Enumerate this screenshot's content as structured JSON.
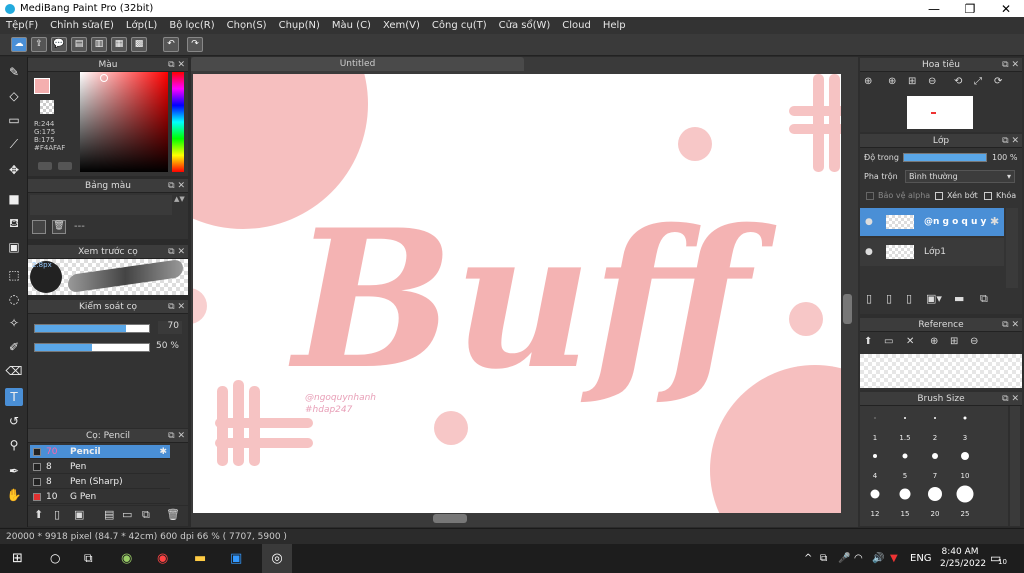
{
  "window": {
    "title": "MediBang Paint Pro (32bit)",
    "controls": [
      "—",
      "❐",
      "✕"
    ]
  },
  "menu": [
    "Tệp(F)",
    "Chỉnh sửa(E)",
    "Lớp(L)",
    "Bộ lọc(R)",
    "Chọn(S)",
    "Chụp(N)",
    "Màu (C)",
    "Xem(V)",
    "Công cụ(T)",
    "Cửa sổ(W)",
    "Cloud",
    "Help"
  ],
  "color_panel": {
    "title": "Màu",
    "r": "R:244",
    "g": "G:175",
    "b": "B:175",
    "hex": "#F4AFAF",
    "fg_color": "#F4AFAF"
  },
  "palette_panel": {
    "title": "Bảng màu",
    "value": "---"
  },
  "preview_panel": {
    "title": "Xem trước cọ",
    "size": "2.8px"
  },
  "brush_control": {
    "title": "Kiểm soát cọ",
    "size_value": "70",
    "size_fill": 0.8,
    "opacity_value": "50 %",
    "opacity_fill": 0.5
  },
  "brush_list": {
    "title": "Cọ: Pencil",
    "items": [
      {
        "size": "70",
        "name": "Pencil",
        "color": "#222222",
        "selected": true
      },
      {
        "size": "8",
        "name": "Pen",
        "color": "#222222",
        "selected": false
      },
      {
        "size": "8",
        "name": "Pen (Sharp)",
        "color": "#222222",
        "selected": false
      },
      {
        "size": "10",
        "name": "G Pen",
        "color": "#e03030",
        "selected": false
      }
    ]
  },
  "canvas": {
    "tab": "Untitled",
    "main_text": "Buff",
    "watermark_line1": "@ngoquynhanh",
    "watermark_line2": "#hdap247",
    "accent": "#F4AFAF"
  },
  "navigator": {
    "title": "Hoa tiêu"
  },
  "layer_panel": {
    "title": "Lớp",
    "opacity_label": "Độ trong",
    "opacity_value": "100 %",
    "opacity_fill": 1.0,
    "blend_label": "Pha trộn",
    "blend_value": "Bình thường",
    "protect_alpha": "Bảo vệ alpha",
    "clipping": "Xén bớt",
    "lock": "Khóa",
    "layers": [
      {
        "name": "@n g o q u y",
        "selected": true
      },
      {
        "name": "Lớp1",
        "selected": false
      }
    ]
  },
  "reference_panel": {
    "title": "Reference"
  },
  "brush_size_panel": {
    "title": "Brush Size",
    "sizes": [
      "1",
      "1.5",
      "2",
      "3",
      "4",
      "5",
      "7",
      "10",
      "12",
      "15",
      "20",
      "25"
    ]
  },
  "status": {
    "text": "20000 * 9918 pixel  (84.7 * 42cm)  600 dpi  66 %  ( 7707, 5900 )"
  },
  "taskbar": {
    "lang": "ENG",
    "time": "8:40 AM",
    "date": "2/25/2022",
    "notif": "10"
  }
}
